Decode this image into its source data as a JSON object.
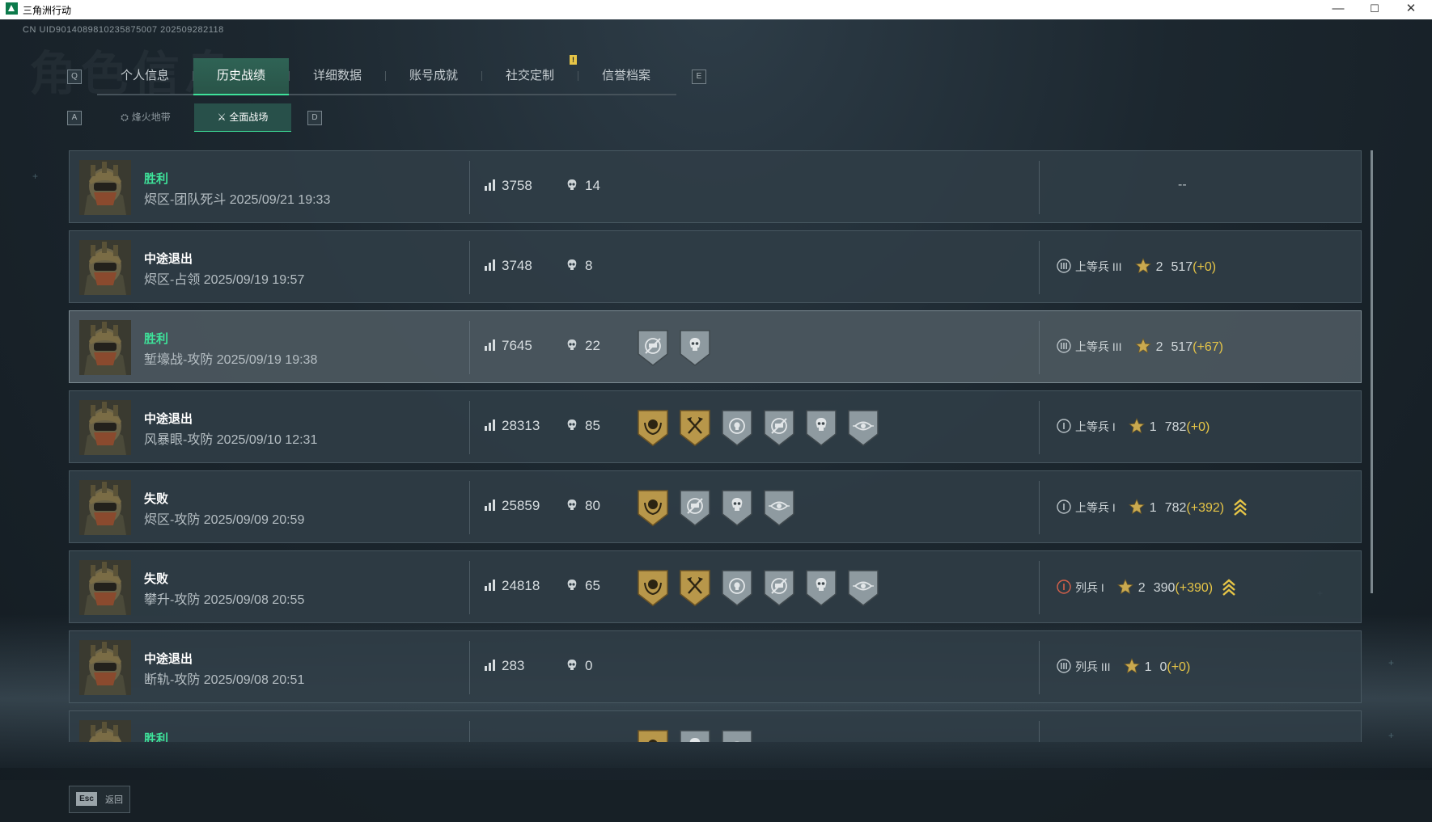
{
  "window": {
    "title": "三角洲行动",
    "minimize": "—",
    "maximize": "☐",
    "close": "✕"
  },
  "header": {
    "uid": "CN UID9014089810235875007 202509282118",
    "watermark": "角色信息"
  },
  "tabs": {
    "left_key": "Q",
    "right_key": "E",
    "items": [
      "个人信息",
      "历史战绩",
      "详细数据",
      "账号成就",
      "社交定制",
      "信誉档案"
    ],
    "active_index": 1,
    "notif_text": "!"
  },
  "subtabs": {
    "left_key": "A",
    "right_key": "D",
    "items": [
      "烽火地带",
      "全面战场"
    ],
    "active_index": 1
  },
  "colors": {
    "accent_green": "#3ee29a",
    "gold": "#e6c547",
    "medal_gold": "#b8974a",
    "medal_gray": "#8e9aa0"
  },
  "matches": [
    {
      "result": "胜利",
      "win": true,
      "map": "烬区-团队死斗 2025/09/21 19:33",
      "score": "3758",
      "kills": "14",
      "medals": [],
      "no_rank": "--"
    },
    {
      "result": "中途退出",
      "win": false,
      "map": "烬区-占领 2025/09/19 19:57",
      "score": "3748",
      "kills": "8",
      "medals": [],
      "rank": {
        "icon": "rank-corporal-3-icon",
        "name": "上等兵 III",
        "level": "2",
        "points": "517",
        "delta": "(+0)",
        "promo": false
      }
    },
    {
      "result": "胜利",
      "win": true,
      "map": "堑壕战-攻防 2025/09/19 19:38",
      "score": "7645",
      "kills": "22",
      "medals": [
        {
          "icon": "vehicle-medal-icon",
          "tone": "gray"
        },
        {
          "icon": "skull-medal-icon",
          "tone": "gray"
        }
      ],
      "rank": {
        "icon": "rank-corporal-3-icon",
        "name": "上等兵 III",
        "level": "2",
        "points": "517",
        "delta": "(+67)",
        "promo": false
      }
    },
    {
      "result": "中途退出",
      "win": false,
      "map": "风暴眼-攻防 2025/09/10 12:31",
      "score": "28313",
      "kills": "85",
      "medals": [
        {
          "icon": "wreath-medal-icon",
          "tone": "gold"
        },
        {
          "icon": "crossed-axes-medal-icon",
          "tone": "gold"
        },
        {
          "icon": "target-skull-medal-icon",
          "tone": "gray"
        },
        {
          "icon": "vehicle-medal-icon",
          "tone": "gray"
        },
        {
          "icon": "skull-medal-icon",
          "tone": "gray"
        },
        {
          "icon": "eye-medal-icon",
          "tone": "gray"
        }
      ],
      "rank": {
        "icon": "rank-corporal-1-icon",
        "name": "上等兵 I",
        "level": "1",
        "points": "782",
        "delta": "(+0)",
        "promo": false
      }
    },
    {
      "result": "失败",
      "win": false,
      "map": "烬区-攻防 2025/09/09 20:59",
      "score": "25859",
      "kills": "80",
      "medals": [
        {
          "icon": "wreath-medal-icon",
          "tone": "gold"
        },
        {
          "icon": "vehicle-medal-icon",
          "tone": "gray"
        },
        {
          "icon": "skull-medal-icon",
          "tone": "gray"
        },
        {
          "icon": "eye-medal-icon",
          "tone": "gray"
        }
      ],
      "rank": {
        "icon": "rank-corporal-1-icon",
        "name": "上等兵 I",
        "level": "1",
        "points": "782",
        "delta": "(+392)",
        "promo": true
      }
    },
    {
      "result": "失败",
      "win": false,
      "map": "攀升-攻防 2025/09/08 20:55",
      "score": "24818",
      "kills": "65",
      "medals": [
        {
          "icon": "wreath-medal-icon",
          "tone": "gold"
        },
        {
          "icon": "crossed-axes-medal-icon",
          "tone": "gold"
        },
        {
          "icon": "target-skull-medal-icon",
          "tone": "gray"
        },
        {
          "icon": "vehicle-medal-icon",
          "tone": "gray"
        },
        {
          "icon": "skull-medal-icon",
          "tone": "gray"
        },
        {
          "icon": "eye-medal-icon",
          "tone": "gray"
        }
      ],
      "rank": {
        "icon": "rank-private-1-icon",
        "name": "列兵 I",
        "level": "2",
        "points": "390",
        "delta": "(+390)",
        "promo": true
      }
    },
    {
      "result": "中途退出",
      "win": false,
      "map": "断轨-攻防 2025/09/08 20:51",
      "score": "283",
      "kills": "0",
      "medals": [],
      "rank": {
        "icon": "rank-private-3-icon",
        "name": "列兵 III",
        "level": "1",
        "points": "0",
        "delta": "(+0)",
        "promo": false
      }
    },
    {
      "result": "胜利",
      "win": true,
      "map": "",
      "score": "",
      "kills": "",
      "medals": [
        {
          "icon": "wreath-medal-icon",
          "tone": "gold"
        },
        {
          "icon": "skull-medal-icon",
          "tone": "gray"
        },
        {
          "icon": "eye-medal-icon",
          "tone": "gray"
        }
      ]
    }
  ],
  "footer": {
    "esc_key": "Esc",
    "back_label": "返回"
  }
}
